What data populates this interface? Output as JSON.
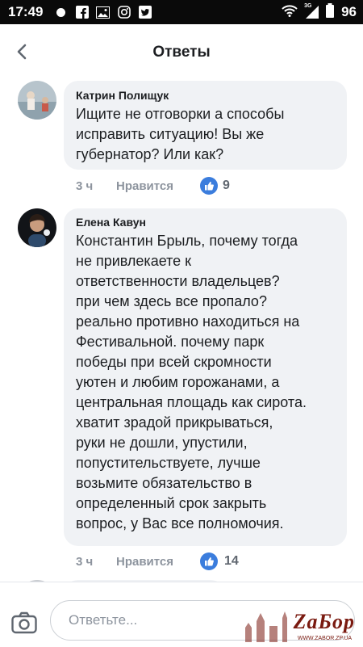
{
  "status_bar": {
    "time": "17:49",
    "network": "3G",
    "battery": "96",
    "icons": [
      "notification-dot-icon",
      "facebook-icon",
      "gallery-icon",
      "instagram-icon",
      "twitter-icon",
      "wifi-icon",
      "signal-icon",
      "battery-icon"
    ]
  },
  "header": {
    "title": "Ответы",
    "back_icon": "chevron-left-icon"
  },
  "comments": [
    {
      "author": "Катрин Полищук",
      "text": "Ищите не отговорки а способы\nисправить ситуацию! Вы же\nгубернатор? Или как?",
      "time": "3 ч",
      "like_label": "Нравится",
      "likes": "9"
    },
    {
      "author": "Елена Кавун",
      "text": "Константин Брыль, почему тогда\nне привлекаете к\nответственности владельцев?\nпри чем здесь все пропало?\nреально противно находиться на\nФестивальной. почему парк\nпобеды при всей скромности\nуютен и любим горожанами, а\nцентральная площадь как сирота.\nхватит зрадой прикрываться,\nруки не дошли, упустили,\nпопустительствуете, лучше\nвозьмите  обязательство в\nопределенный срок закрыть\nвопрос, у Вас все полномочия.",
      "time": "3 ч",
      "like_label": "Нравится",
      "likes": "14"
    }
  ],
  "composer": {
    "placeholder": "Ответьте...",
    "camera_icon": "camera-icon"
  },
  "watermark": {
    "text": "ZaБор",
    "url": "WWW.ZABOR.ZP.UA"
  },
  "colors": {
    "bubble": "#f0f2f5",
    "like_blue": "#3b7ddd",
    "meta_gray": "#8d949e"
  }
}
